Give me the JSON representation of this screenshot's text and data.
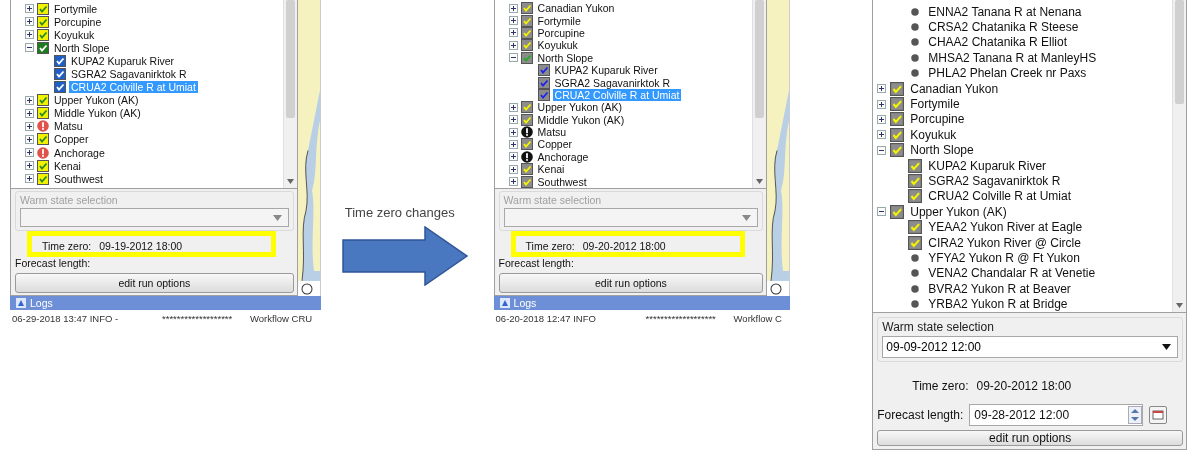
{
  "panels": [
    {
      "tree": [
        {
          "label": "Fortymile",
          "kind": "check",
          "expanded": false,
          "selected": false
        },
        {
          "label": "Porcupine",
          "kind": "check",
          "expanded": false,
          "selected": false
        },
        {
          "label": "Koyukuk",
          "kind": "check",
          "expanded": false,
          "selected": false
        },
        {
          "label": "North Slope",
          "kind": "check-green",
          "expanded": true,
          "selected": false,
          "children": [
            {
              "label": "KUPA2 Kuparuk River",
              "kind": "check-blue",
              "selected": false
            },
            {
              "label": "SGRA2 Sagavanirktok R",
              "kind": "check-blue",
              "selected": false
            },
            {
              "label": "CRUA2 Colville R at Umiat",
              "kind": "check-blue",
              "selected": true
            }
          ]
        },
        {
          "label": "Upper Yukon (AK)",
          "kind": "check",
          "expanded": false,
          "selected": false
        },
        {
          "label": "Middle Yukon (AK)",
          "kind": "check",
          "expanded": false,
          "selected": false
        },
        {
          "label": "Matsu",
          "kind": "alert",
          "expanded": false,
          "selected": false
        },
        {
          "label": "Copper",
          "kind": "check",
          "expanded": false,
          "selected": false
        },
        {
          "label": "Anchorage",
          "kind": "alert",
          "expanded": false,
          "selected": false
        },
        {
          "label": "Kenai",
          "kind": "check",
          "expanded": false,
          "selected": false
        },
        {
          "label": "Southwest",
          "kind": "check",
          "expanded": false,
          "selected": false
        }
      ],
      "warm_state": {
        "label": "Warm state selection",
        "disabled": true
      },
      "time_zero": {
        "label": "Time zero:",
        "value": "09-19-2012 18:00",
        "highlighted": true
      },
      "forecast": {
        "label": "Forecast length:"
      },
      "button": "edit run options",
      "map": {
        "kind": "picture"
      },
      "logs": {
        "title": "Logs",
        "columns": [
          "06-29-2018 13:47 INFO -",
          "*******************",
          "Workflow CRU"
        ]
      }
    },
    {
      "tree": [
        {
          "label": "Canadian Yukon",
          "kind": "check",
          "expanded": false,
          "selected": false
        },
        {
          "label": "Fortymile",
          "kind": "check",
          "expanded": false,
          "selected": false
        },
        {
          "label": "Porcupine",
          "kind": "check",
          "expanded": false,
          "selected": false
        },
        {
          "label": "Koyukuk",
          "kind": "check",
          "expanded": false,
          "selected": false
        },
        {
          "label": "North Slope",
          "kind": "check-green",
          "expanded": true,
          "selected": false,
          "children": [
            {
              "label": "KUPA2 Kuparuk River",
              "kind": "check-blue",
              "selected": false
            },
            {
              "label": "SGRA2 Sagavanirktok R",
              "kind": "check-blue",
              "selected": false
            },
            {
              "label": "CRUA2 Colville R at Umiat",
              "kind": "check-blue",
              "selected": true
            }
          ]
        },
        {
          "label": "Upper Yukon (AK)",
          "kind": "check",
          "expanded": false,
          "selected": false
        },
        {
          "label": "Middle Yukon (AK)",
          "kind": "check",
          "expanded": false,
          "selected": false
        },
        {
          "label": "Matsu",
          "kind": "alert",
          "expanded": false,
          "selected": false
        },
        {
          "label": "Copper",
          "kind": "check",
          "expanded": false,
          "selected": false
        },
        {
          "label": "Anchorage",
          "kind": "alert",
          "expanded": false,
          "selected": false
        },
        {
          "label": "Kenai",
          "kind": "check",
          "expanded": false,
          "selected": false
        },
        {
          "label": "Southwest",
          "kind": "check",
          "expanded": false,
          "selected": false
        }
      ],
      "warm_state": {
        "label": "Warm state selection",
        "disabled": true
      },
      "time_zero": {
        "label": "Time zero:",
        "value": "09-20-2012 18:00",
        "highlighted": true
      },
      "forecast": {
        "label": "Forecast length:"
      },
      "button": "edit run options",
      "map": {
        "kind": "picture"
      },
      "logs": {
        "title": "Logs",
        "columns": [
          "06-20-2018 12:47 INFO",
          "*******************",
          "Workflow C"
        ]
      }
    },
    {
      "tree": [
        {
          "children": [
            {
              "label": "ENNA2 Tanana R at Nenana",
              "kind": "dot",
              "selected": false
            },
            {
              "label": "CRSA2 Chatanika R Steese",
              "kind": "dot",
              "selected": false
            },
            {
              "label": "CHAA2 Chatanika R Elliot",
              "kind": "dot",
              "selected": false
            },
            {
              "label": "MHSA2 Tanana R at ManleyHS",
              "kind": "dot",
              "selected": false
            },
            {
              "label": "PHLA2 Phelan Creek nr Paxs",
              "kind": "dot",
              "selected": false
            }
          ]
        },
        {
          "label": "Canadian Yukon",
          "kind": "check",
          "expanded": false,
          "selected": false
        },
        {
          "label": "Fortymile",
          "kind": "check",
          "expanded": false,
          "selected": false
        },
        {
          "label": "Porcupine",
          "kind": "check",
          "expanded": false,
          "selected": false
        },
        {
          "label": "Koyukuk",
          "kind": "check",
          "expanded": false,
          "selected": false
        },
        {
          "label": "North Slope",
          "kind": "check",
          "expanded": true,
          "selected": false,
          "children": [
            {
              "label": "KUPA2 Kuparuk River",
              "kind": "check",
              "selected": false
            },
            {
              "label": "SGRA2 Sagavanirktok R",
              "kind": "check",
              "selected": false
            },
            {
              "label": "CRUA2 Colville R at Umiat",
              "kind": "check",
              "selected": false
            }
          ]
        },
        {
          "label": "Upper Yukon (AK)",
          "kind": "check",
          "expanded": true,
          "selected": false,
          "children": [
            {
              "label": "YEAA2 Yukon River at Eagle",
              "kind": "check",
              "selected": false
            },
            {
              "label": "CIRA2 Yukon River @ Circle",
              "kind": "check",
              "selected": false
            },
            {
              "label": "YFYA2 Yukon R @ Ft Yukon",
              "kind": "dot",
              "selected": false
            },
            {
              "label": "VENA2 Chandalar R at Venetie",
              "kind": "dot",
              "selected": false
            },
            {
              "label": "BVRA2 Yukon R at Beaver",
              "kind": "dot",
              "selected": false
            },
            {
              "label": "YRBA2 Yukon R at Bridge",
              "kind": "dot",
              "selected": false
            }
          ]
        }
      ],
      "warm_state": {
        "label": "Warm state selection",
        "value": "09-09-2012 12:00",
        "disabled": false
      },
      "time_zero": {
        "label": "Time zero:",
        "value": "09-20-2012 18:00",
        "highlighted": false
      },
      "forecast": {
        "label": "Forecast length:",
        "value": "09-28-2012 12:00"
      },
      "button": "edit run options"
    }
  ],
  "arrow": {
    "caption": "Time zero changes"
  }
}
